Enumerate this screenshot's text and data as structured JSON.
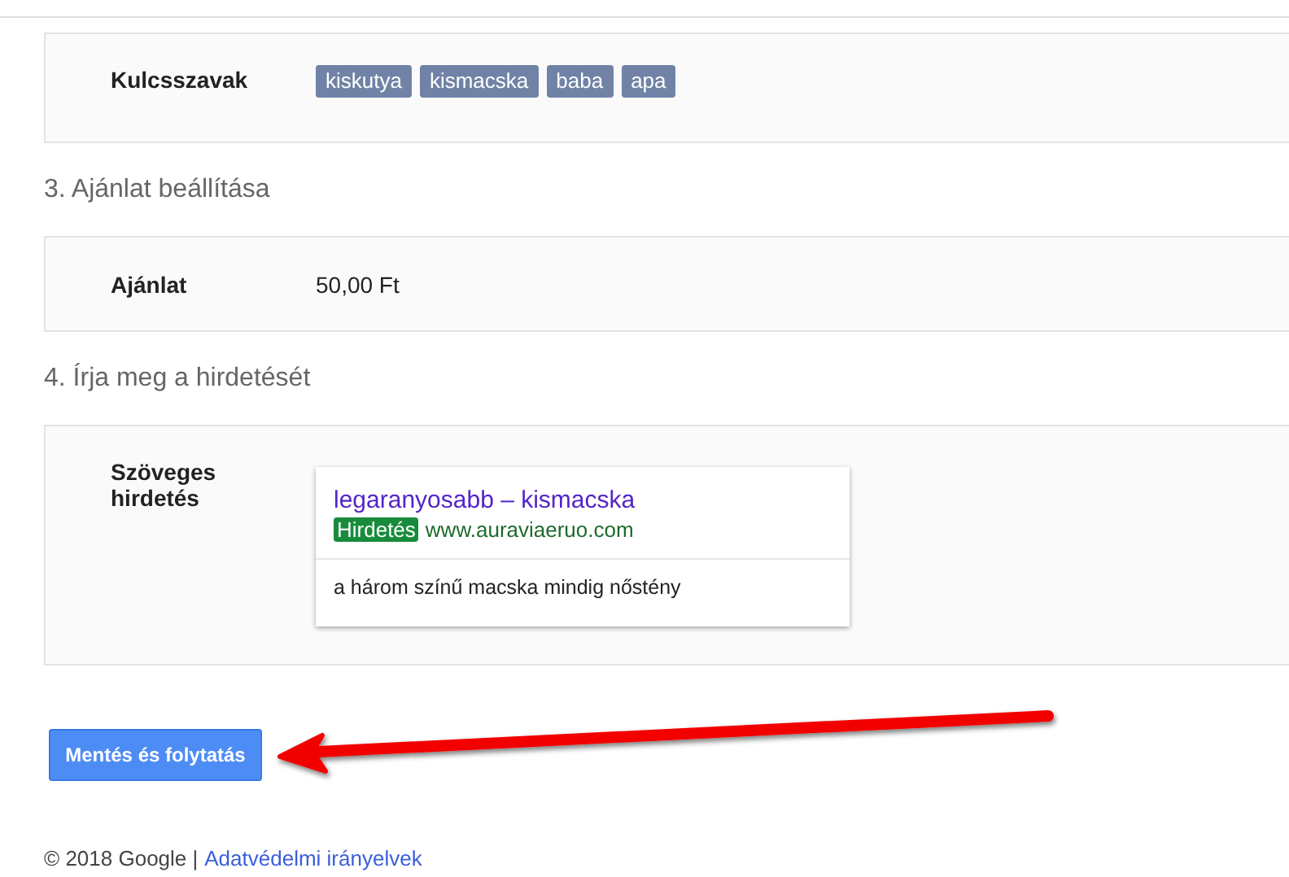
{
  "keywords_section": {
    "label": "Kulcsszavak",
    "tags": [
      "kiskutya",
      "kismacska",
      "baba",
      "apa"
    ]
  },
  "bid_section": {
    "heading": "3. Ajánlat beállítása",
    "label": "Ajánlat",
    "value": "50,00 Ft"
  },
  "ad_section": {
    "heading": "4. Írja meg a hirdetését",
    "label": "Szöveges hirdetés",
    "ad": {
      "title": "legaranyosabb – kismacska",
      "badge": "Hirdetés",
      "url": "www.auraviaeruo.com",
      "description": "a három színű macska mindig nőstény"
    }
  },
  "save_button": "Mentés és folytatás",
  "footer": {
    "copyright": "© 2018 Google |",
    "link": "Adatvédelmi irányelvek"
  }
}
